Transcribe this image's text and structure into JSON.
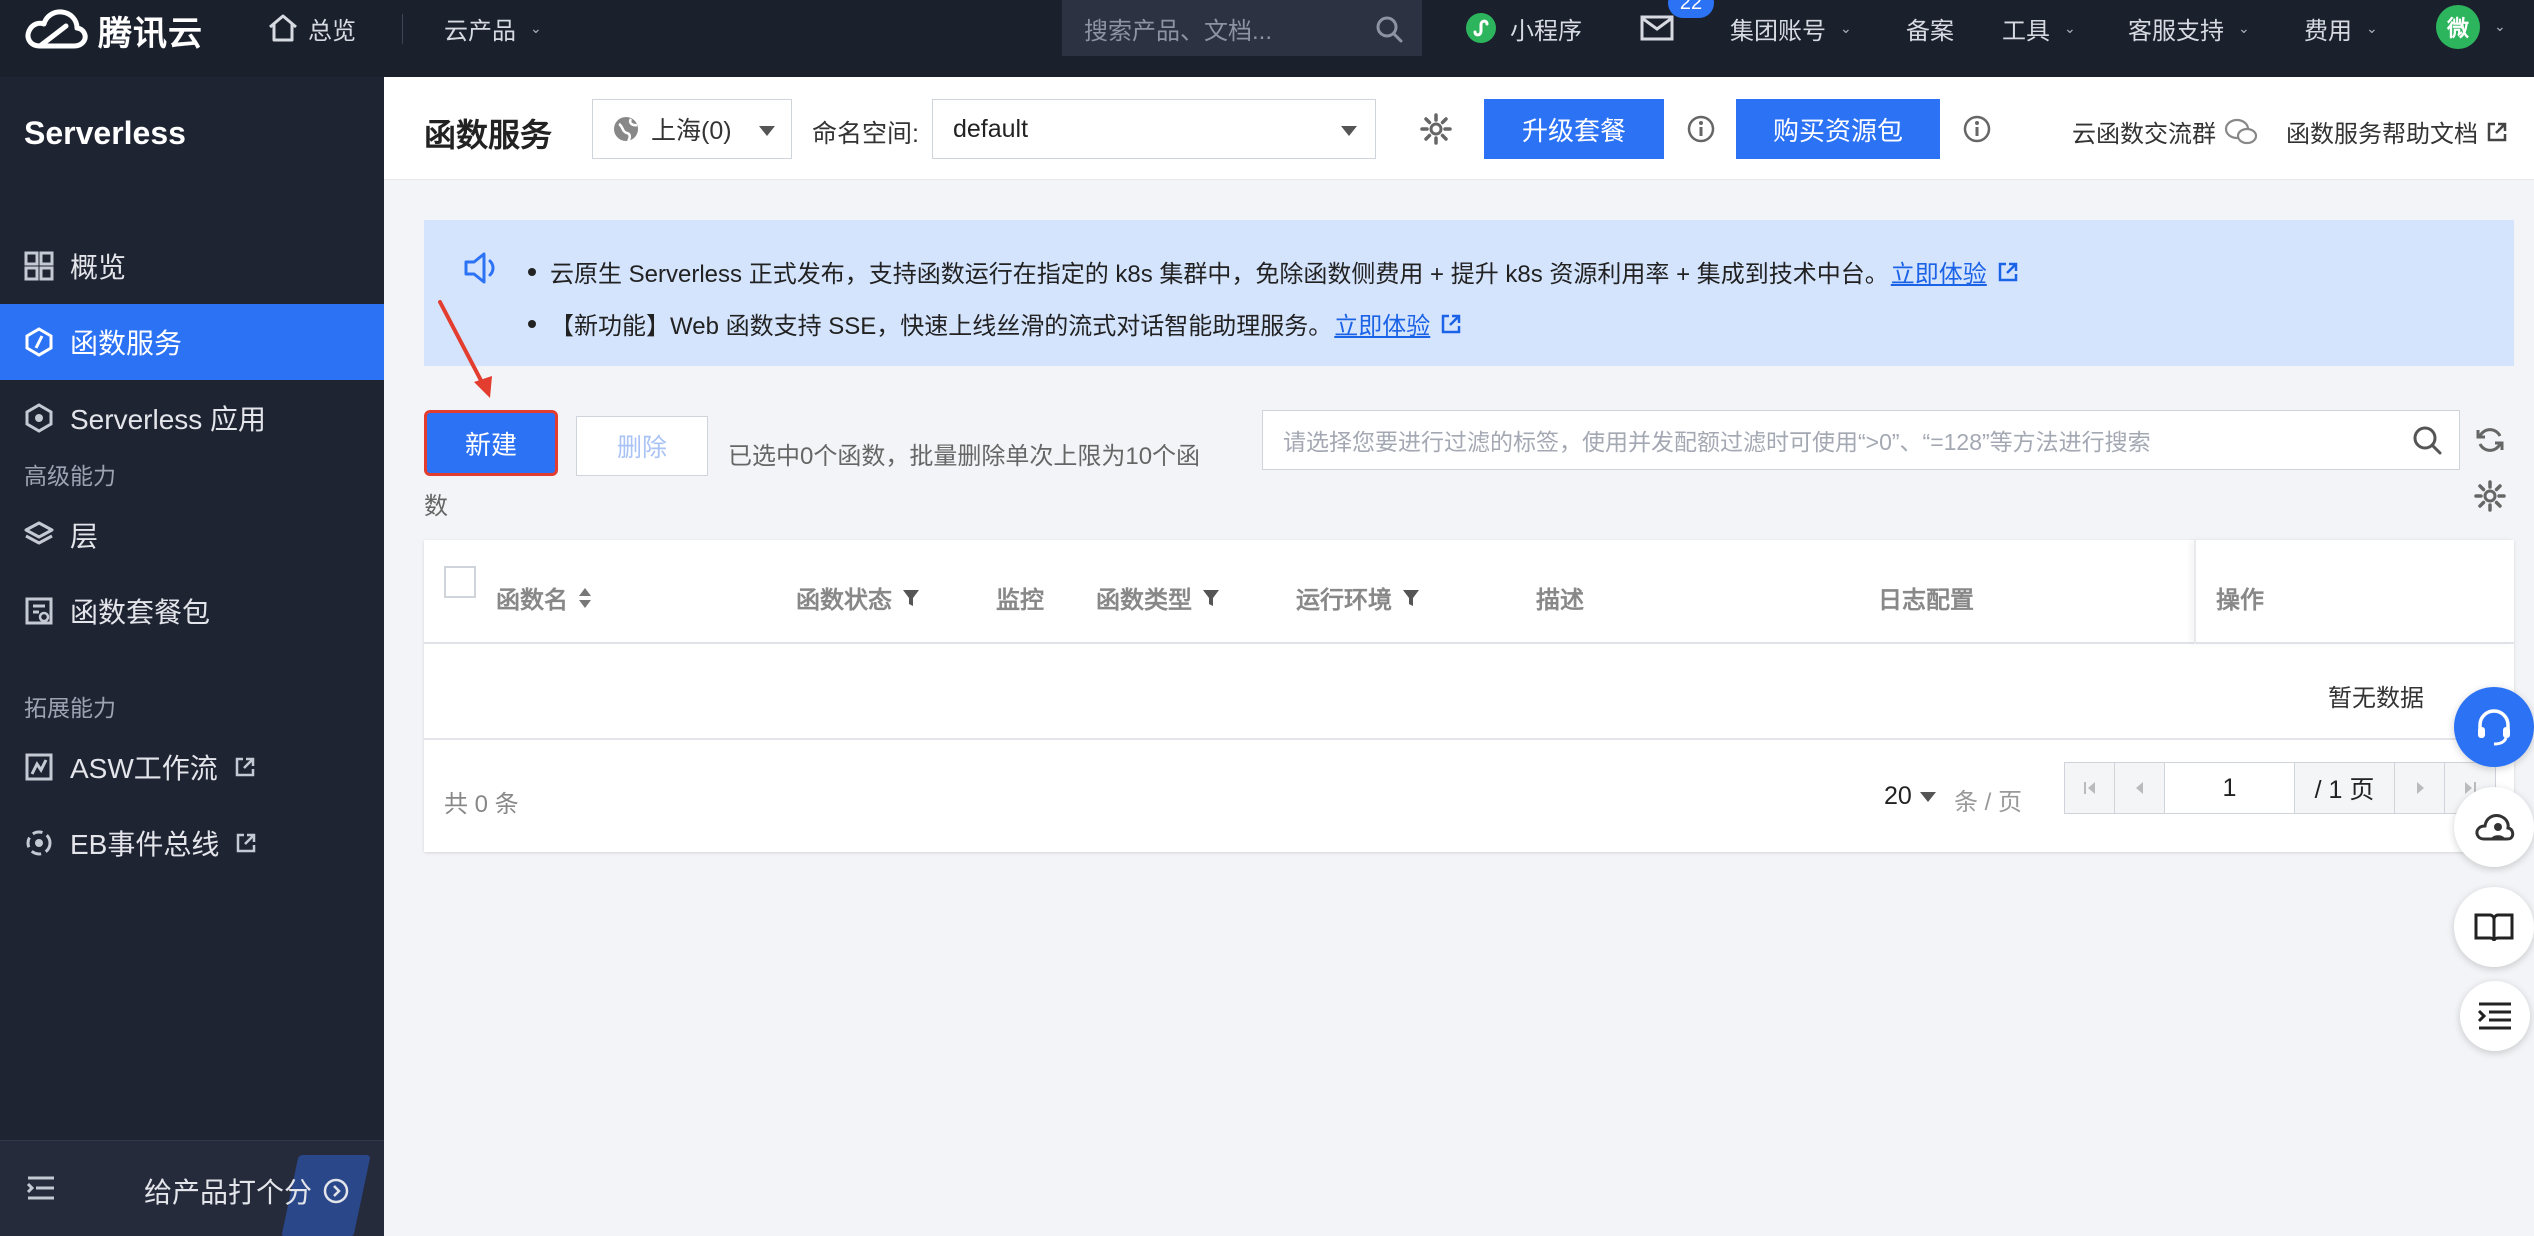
{
  "topbar": {
    "brand": "腾讯云",
    "overview": "总览",
    "products": "云产品",
    "search_placeholder": "搜索产品、文档...",
    "miniprogram": "小程序",
    "mail_badge": "22",
    "account": "集团账号",
    "filing": "备案",
    "tools": "工具",
    "support": "客服支持",
    "billing": "费用",
    "avatar": "微"
  },
  "sidebar": {
    "title": "Serverless",
    "items": [
      {
        "label": "概览"
      },
      {
        "label": "函数服务"
      },
      {
        "label": "Serverless 应用"
      }
    ],
    "group_advanced": "高级能力",
    "advanced_items": [
      {
        "label": "层"
      },
      {
        "label": "函数套餐包"
      }
    ],
    "group_extend": "拓展能力",
    "extend_items": [
      {
        "label": "ASW工作流"
      },
      {
        "label": "EB事件总线"
      }
    ],
    "rate": "给产品打个分"
  },
  "header": {
    "title": "函数服务",
    "region": "上海(0)",
    "namespace_label": "命名空间:",
    "namespace": "default",
    "upgrade": "升级套餐",
    "buy": "购买资源包",
    "community": "云函数交流群",
    "help": "函数服务帮助文档"
  },
  "notice": {
    "line1": "云原生 Serverless 正式发布，支持函数运行在指定的 k8s 集群中，免除函数侧费用 + 提升 k8s 资源利用率 + 集成到技术中台。",
    "line1_link": "立即体验",
    "line2": "【新功能】Web 函数支持 SSE，快速上线丝滑的流式对话智能助理服务。",
    "line2_link": "立即体验"
  },
  "toolbar": {
    "new": "新建",
    "delete": "删除",
    "selection_tip": "已选中0个函数，批量删除单次上限为10个函数",
    "filter_placeholder": "请选择您要进行过滤的标签，使用并发配额过滤时可使用“>0”、“=128”等方法进行搜索"
  },
  "table": {
    "columns": [
      "函数名",
      "函数状态",
      "监控",
      "函数类型",
      "运行环境",
      "描述",
      "日志配置",
      "操作"
    ],
    "empty": "暂无数据",
    "total": "共 0 条",
    "page_size": "20",
    "per_page": "条 / 页",
    "page": "1",
    "page_total": "/ 1 页"
  },
  "colors": {
    "primary": "#2c72f5",
    "topbar": "#1b202d",
    "sidebar": "#1f2433",
    "highlight": "#e23d2f"
  }
}
